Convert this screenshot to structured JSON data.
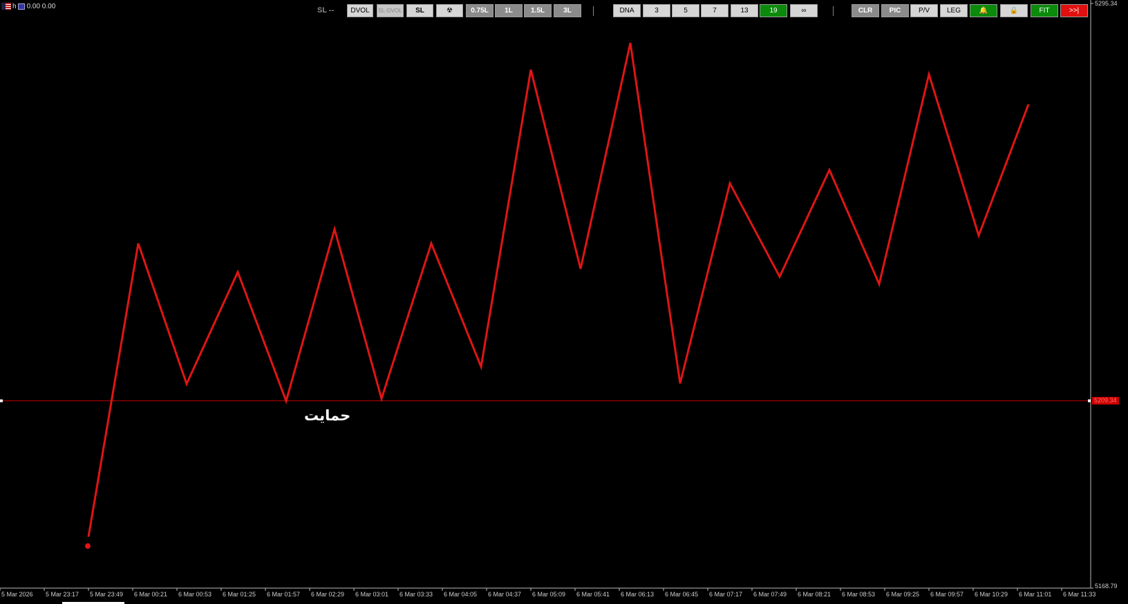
{
  "top_left": {
    "symbol": "h",
    "values": "0.00 0.00"
  },
  "toolbar": {
    "sl_label": "SL --",
    "groups": [
      {
        "label": "DVOL",
        "style": "light"
      },
      {
        "label": "SL-DVOL",
        "style": "dim"
      },
      {
        "label": "SL",
        "style": "light-bold"
      },
      {
        "label": "☢",
        "style": "light"
      },
      {
        "label": "0.75L",
        "style": "dark"
      },
      {
        "label": "1L",
        "style": "dark"
      },
      {
        "label": "1.5L",
        "style": "dark"
      },
      {
        "label": "3L",
        "style": "dark"
      },
      {
        "label": "DNA",
        "style": "light"
      },
      {
        "label": "3",
        "style": "light"
      },
      {
        "label": "5",
        "style": "light"
      },
      {
        "label": "7",
        "style": "light"
      },
      {
        "label": "13",
        "style": "light"
      },
      {
        "label": "19",
        "style": "green"
      },
      {
        "label": "∞",
        "style": "light"
      },
      {
        "label": "CLR",
        "style": "dark"
      },
      {
        "label": "PIC",
        "style": "dark"
      },
      {
        "label": "P/V",
        "style": "light"
      },
      {
        "label": "LEG",
        "style": "light"
      },
      {
        "label": "🔔",
        "style": "green"
      },
      {
        "label": "🔒",
        "style": "light"
      },
      {
        "label": "FIT",
        "style": "green"
      },
      {
        "label": ">>|",
        "style": "red"
      }
    ]
  },
  "colors": {
    "background": "#000000",
    "line": "#e01515",
    "support_line": "#c00000",
    "axis": "#bbbbbb"
  },
  "chart_data": {
    "type": "line",
    "y_axis_labels": [
      "5295.34",
      "5168.79"
    ],
    "ylim": [
      5168.79,
      5295.34
    ],
    "support_level": {
      "value": 5209.34,
      "label_text": "5209.34",
      "annotation": "حمایت"
    },
    "x_tick_labels": [
      "5 Mar 2026",
      "5 Mar 23:17",
      "5 Mar 23:49",
      "6 Mar 00:21",
      "6 Mar 00:53",
      "6 Mar 01:25",
      "6 Mar 01:57",
      "6 Mar 02:29",
      "6 Mar 03:01",
      "6 Mar 03:33",
      "6 Mar 04:05",
      "6 Mar 04:37",
      "6 Mar 05:09",
      "6 Mar 05:41",
      "6 Mar 06:13",
      "6 Mar 06:45",
      "6 Mar 07:17",
      "6 Mar 07:49",
      "6 Mar 08:21",
      "6 Mar 08:53",
      "6 Mar 09:25",
      "6 Mar 09:57",
      "6 Mar 10:29",
      "6 Mar 11:01",
      "6 Mar 11:33"
    ],
    "series": [
      {
        "points": [
          {
            "x": "5 Mar 23:49",
            "y": 5179.9
          },
          {
            "x": "6 Mar 00:25",
            "y": 5243.4
          },
          {
            "x": "6 Mar 01:00",
            "y": 5213.0
          },
          {
            "x": "6 Mar 01:37",
            "y": 5237.2
          },
          {
            "x": "6 Mar 02:12",
            "y": 5209.3
          },
          {
            "x": "6 Mar 02:47",
            "y": 5246.5
          },
          {
            "x": "6 Mar 03:21",
            "y": 5209.8
          },
          {
            "x": "6 Mar 03:57",
            "y": 5243.4
          },
          {
            "x": "6 Mar 04:33",
            "y": 5216.7
          },
          {
            "x": "6 Mar 05:09",
            "y": 5281.0
          },
          {
            "x": "6 Mar 05:45",
            "y": 5237.9
          },
          {
            "x": "6 Mar 06:21",
            "y": 5286.8
          },
          {
            "x": "6 Mar 06:57",
            "y": 5213.1
          },
          {
            "x": "6 Mar 07:33",
            "y": 5256.4
          },
          {
            "x": "6 Mar 08:09",
            "y": 5236.2
          },
          {
            "x": "6 Mar 08:45",
            "y": 5259.3
          },
          {
            "x": "6 Mar 09:21",
            "y": 5234.6
          },
          {
            "x": "6 Mar 09:57",
            "y": 5280.0
          },
          {
            "x": "6 Mar 10:33",
            "y": 5245.1
          },
          {
            "x": "6 Mar 11:09",
            "y": 5273.5
          }
        ]
      }
    ],
    "start_marker": {
      "x": "5 Mar 23:49",
      "y": 5177.9
    },
    "grid": false
  }
}
